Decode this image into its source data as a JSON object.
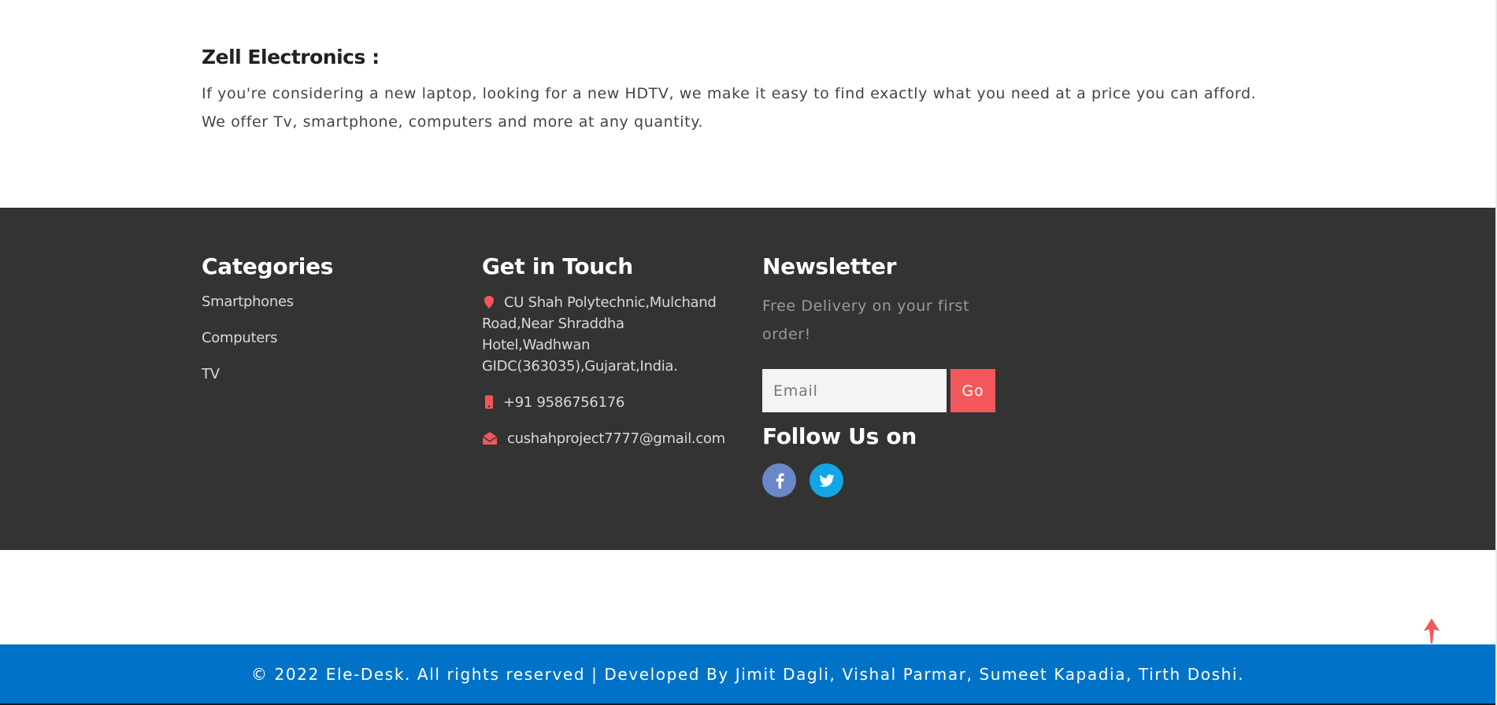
{
  "about": {
    "title": "Zell Electronics :",
    "text": "If you're considering a new laptop, looking for a new HDTV, we make it easy to find exactly what you need at a price you can afford. We offer Tv, smartphone, computers and more at any quantity."
  },
  "footer": {
    "categories": {
      "title": "Categories",
      "items": [
        "Smartphones",
        "Computers",
        "TV"
      ]
    },
    "contact": {
      "title": "Get in Touch",
      "address": "CU Shah Polytechnic,Mulchand Road,Near Shraddha Hotel,Wadhwan GIDC(363035),Gujarat,India.",
      "phone": "+91 9586756176",
      "email": "cushahproject7777@gmail.com"
    },
    "newsletter": {
      "title": "Newsletter",
      "text": "Free Delivery on your first order!",
      "email_placeholder": "Email",
      "go_label": "Go",
      "follow_title": "Follow Us on"
    }
  },
  "bottombar": {
    "copyright": "© 2022 Ele-Desk. All rights reserved | Developed By Jimit Dagli, Vishal Parmar, Sumeet Kapadia, Tirth Doshi."
  },
  "colors": {
    "footer_bg": "#333333",
    "accent": "#f2585b",
    "bottombar_bg": "#0073c8",
    "facebook": "#6a88c8",
    "twitter": "#12a6e4"
  },
  "icons": {
    "address": "map-marker-icon",
    "phone": "mobile-phone-icon",
    "email": "envelope-open-icon",
    "facebook": "facebook-icon",
    "twitter": "twitter-icon",
    "back_to_top": "arrow-up-icon"
  }
}
